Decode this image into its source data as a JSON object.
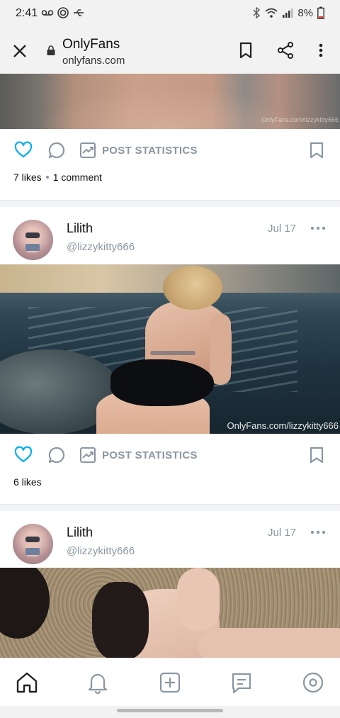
{
  "status_bar": {
    "time": "2:41",
    "battery": "8%",
    "icons": [
      "voicemail-icon",
      "vpn-icon",
      "usb-icon",
      "bluetooth-icon",
      "wifi-icon",
      "signal-icon",
      "battery-icon"
    ]
  },
  "browser": {
    "title": "OnlyFans",
    "url": "onlyfans.com",
    "icons": [
      "close-icon",
      "lock-icon",
      "bookmark-icon",
      "share-icon",
      "more-vert-icon"
    ]
  },
  "colors": {
    "accent": "#00aff0",
    "muted": "#8a96a3",
    "divider": "#f2f4f5"
  },
  "feed": {
    "post_1": {
      "watermark": "OnlyFans.com/lizzykitty666",
      "stats_label": "POST STATISTICS",
      "likes": "7 likes",
      "comments": "1 comment"
    },
    "post_2": {
      "name": "Lilith",
      "handle": "@lizzykitty666",
      "date": "Jul 17",
      "watermark": "OnlyFans.com/lizzykitty666",
      "stats_label": "POST STATISTICS",
      "likes": "6 likes"
    },
    "post_3": {
      "name": "Lilith",
      "handle": "@lizzykitty666",
      "date": "Jul 17"
    }
  },
  "bottom_nav": {
    "items": [
      "home-icon",
      "notifications-icon",
      "add-post-icon",
      "messages-icon",
      "profile-icon"
    ]
  }
}
